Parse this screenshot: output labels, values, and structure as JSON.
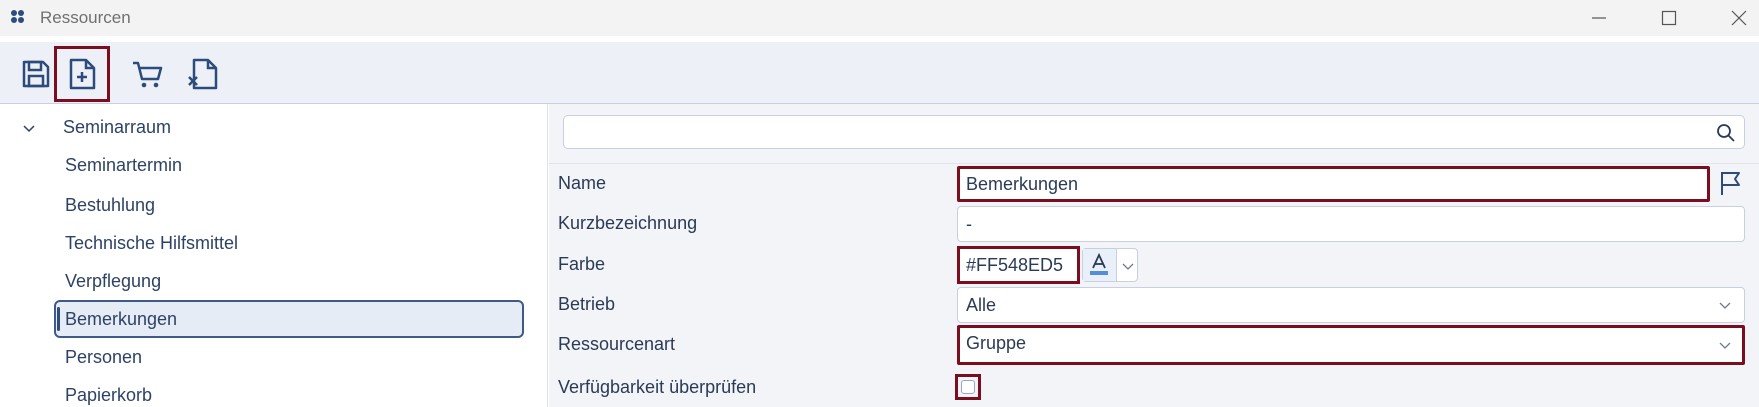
{
  "window": {
    "title": "Ressourcen"
  },
  "toolbar": {
    "buttons": [
      {
        "name": "save-icon"
      },
      {
        "name": "new-document-icon"
      },
      {
        "name": "cart-icon"
      },
      {
        "name": "delete-document-icon"
      }
    ]
  },
  "tree": {
    "parent": "Seminarraum",
    "items": [
      "Seminartermin",
      "Bestuhlung",
      "Technische Hilfsmittel",
      "Verpflegung",
      "Bemerkungen",
      "Personen",
      "Papierkorb"
    ],
    "selected": "Bemerkungen"
  },
  "search": {
    "placeholder": ""
  },
  "form": {
    "name_label": "Name",
    "name_value": "Bemerkungen",
    "kurz_label": "Kurzbezeichnung",
    "kurz_value": "-",
    "farbe_label": "Farbe",
    "farbe_value": "#FF548ED5",
    "betrieb_label": "Betrieb",
    "betrieb_value": "Alle",
    "ressourcenart_label": "Ressourcenart",
    "ressourcenart_value": "Gruppe",
    "verfuegbarkeit_label": "Verfügbarkeit überprüfen",
    "verfuegbarkeit_checked": false
  },
  "colors": {
    "highlight": "#7a0d1e",
    "accent": "#2d4c7c",
    "selected_bg": "#e6ecf5",
    "color_swatch": "#548ED5"
  }
}
